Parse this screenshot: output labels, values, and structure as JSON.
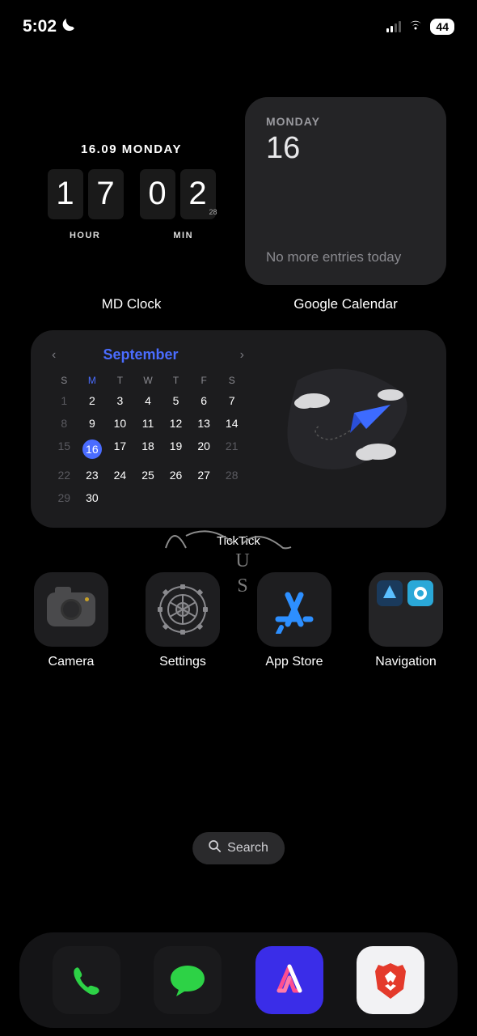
{
  "status": {
    "time": "5:02",
    "dnd_icon": "moon-icon",
    "battery": "44"
  },
  "widgets": {
    "mdclock": {
      "date_line": "16.09 MONDAY",
      "h1": "1",
      "h2": "7",
      "m1": "0",
      "m2": "2",
      "seconds": "28",
      "label_hour": "HOUR",
      "label_min": "MIN",
      "label": "MD Clock"
    },
    "gcal": {
      "weekday": "MONDAY",
      "date": "16",
      "message": "No more entries today",
      "label": "Google Calendar"
    },
    "ticktick": {
      "month": "September",
      "dow": [
        "S",
        "M",
        "T",
        "W",
        "T",
        "F",
        "S"
      ],
      "weeks": [
        [
          {
            "n": "1",
            "dim": true
          },
          {
            "n": "2"
          },
          {
            "n": "3"
          },
          {
            "n": "4"
          },
          {
            "n": "5"
          },
          {
            "n": "6"
          },
          {
            "n": "7"
          }
        ],
        [
          {
            "n": "8",
            "dim": true
          },
          {
            "n": "9"
          },
          {
            "n": "10"
          },
          {
            "n": "11"
          },
          {
            "n": "12"
          },
          {
            "n": "13"
          },
          {
            "n": "14"
          }
        ],
        [
          {
            "n": "15",
            "dim": true
          },
          {
            "n": "16",
            "today": true
          },
          {
            "n": "17"
          },
          {
            "n": "18"
          },
          {
            "n": "19"
          },
          {
            "n": "20"
          },
          {
            "n": "21",
            "dim": true
          }
        ],
        [
          {
            "n": "22",
            "dim": true
          },
          {
            "n": "23"
          },
          {
            "n": "24"
          },
          {
            "n": "25"
          },
          {
            "n": "26"
          },
          {
            "n": "27"
          },
          {
            "n": "28",
            "dim": true
          }
        ],
        [
          {
            "n": "29",
            "dim": true
          },
          {
            "n": "30"
          },
          {
            "n": ""
          },
          {
            "n": ""
          },
          {
            "n": ""
          },
          {
            "n": ""
          },
          {
            "n": ""
          }
        ]
      ],
      "label": "TickTick"
    }
  },
  "apps": [
    {
      "id": "camera",
      "label": "Camera"
    },
    {
      "id": "settings",
      "label": "Settings"
    },
    {
      "id": "appstore",
      "label": "App Store"
    },
    {
      "id": "navigation",
      "label": "Navigation"
    }
  ],
  "search": {
    "label": "Search"
  },
  "dock": [
    {
      "id": "phone"
    },
    {
      "id": "messages"
    },
    {
      "id": "arc"
    },
    {
      "id": "brave"
    }
  ]
}
